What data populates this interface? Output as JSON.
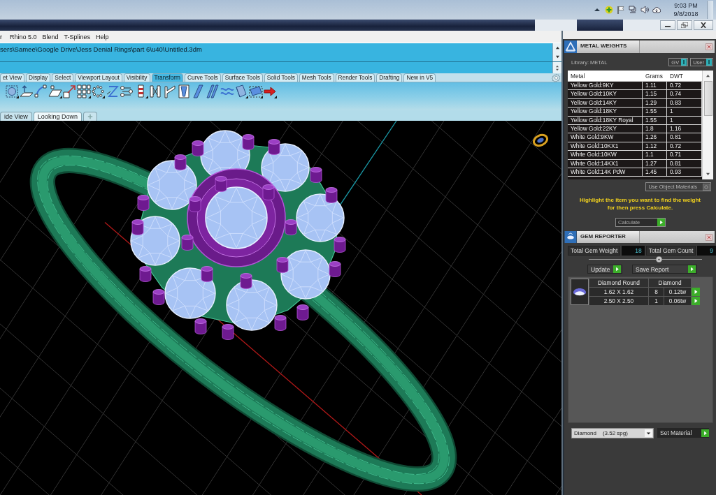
{
  "taskbar": {
    "time": "9:03 PM",
    "date": "9/8/2018"
  },
  "menu_bar": [
    "r",
    "Rhino 5.0",
    "Blend",
    "T-Splines",
    "Help"
  ],
  "command_history": [
    "sers\\Samee\\Google Drive\\Jess Denial Rings\\part 6\\u40\\Untitled.3dm"
  ],
  "toolbar_tabs": [
    {
      "label": "et View",
      "selected": false
    },
    {
      "label": "Display",
      "selected": false
    },
    {
      "label": "Select",
      "selected": false
    },
    {
      "label": "Viewport Layout",
      "selected": false
    },
    {
      "label": "Visibility",
      "selected": false
    },
    {
      "label": "Transform",
      "selected": true
    },
    {
      "label": "Curve Tools",
      "selected": false
    },
    {
      "label": "Surface Tools",
      "selected": false
    },
    {
      "label": "Solid Tools",
      "selected": false
    },
    {
      "label": "Mesh Tools",
      "selected": false
    },
    {
      "label": "Render Tools",
      "selected": false
    },
    {
      "label": "Drafting",
      "selected": false
    },
    {
      "label": "New in V5",
      "selected": false
    }
  ],
  "viewport_tabs": [
    {
      "label": "ide View",
      "selected": false
    },
    {
      "label": "Looking Down",
      "selected": true
    }
  ],
  "metal_weights": {
    "title": "METAL WEIGHTS",
    "library": "Library: METAL",
    "toggles": [
      {
        "label": "GV",
        "on": true
      },
      {
        "label": "User",
        "on": true
      }
    ],
    "columns": [
      "Metal",
      "Grams",
      "DWT"
    ],
    "rows": [
      [
        "Yellow Gold:9KY",
        "1.11",
        "0.72"
      ],
      [
        "Yellow Gold:10KY",
        "1.15",
        "0.74"
      ],
      [
        "Yellow Gold:14KY",
        "1.29",
        "0.83"
      ],
      [
        "Yellow Gold:18KY",
        "1.55",
        "1"
      ],
      [
        "Yellow Gold:18KY Royal",
        "1.55",
        "1"
      ],
      [
        "Yellow Gold:22KY",
        "1.8",
        "1.16"
      ],
      [
        "White Gold:9KW",
        "1.26",
        "0.81"
      ],
      [
        "White Gold:10KX1",
        "1.12",
        "0.72"
      ],
      [
        "White Gold:10KW",
        "1.1",
        "0.71"
      ],
      [
        "White Gold:14KX1",
        "1.27",
        "0.81"
      ],
      [
        "White Gold:14K PdW",
        "1.45",
        "0.93"
      ]
    ],
    "use_object_materials": {
      "label": "Use Object Materials",
      "on": false
    },
    "hint": "Highlight the item you want to find the weight for then press Calculate.",
    "calculate": "Calculate"
  },
  "gem_reporter": {
    "title": "GEM REPORTER",
    "total_weight": {
      "label": "Total Gem Weight",
      "value": "18"
    },
    "total_count": {
      "label": "Total Gem Count",
      "value": "9"
    },
    "buttons": [
      "Update",
      "Save Report"
    ],
    "columns": [
      "Diamond Round",
      "Diamond"
    ],
    "rows": [
      {
        "size": "1.62 X 1.62",
        "count": "8",
        "weight": "0.12tw"
      },
      {
        "size": "2.50 X 2.50",
        "count": "1",
        "weight": "0.06tw"
      }
    ],
    "material": "Diamond    (3.52 spg)",
    "set_material": "Set Material"
  }
}
